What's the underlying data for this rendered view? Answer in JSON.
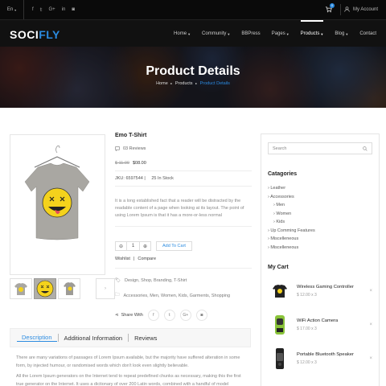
{
  "topbar": {
    "language": "En",
    "language_caret": "▾",
    "social": [
      "f",
      "𝕥",
      "G+",
      "in",
      "◙"
    ],
    "cart_count": "0",
    "account": "My Account"
  },
  "nav": {
    "logo_main": "SOCI",
    "logo_accent": "FLY",
    "items": [
      {
        "label": "Home"
      },
      {
        "label": "Community"
      },
      {
        "label": "BBPress"
      },
      {
        "label": "Pages"
      },
      {
        "label": "Products"
      },
      {
        "label": "Blog"
      },
      {
        "label": "Contact"
      }
    ]
  },
  "hero": {
    "title": "Product Details",
    "crumb_home": "Home",
    "crumb_mid": "Products",
    "crumb_current": "Product Details",
    "crumb_sep": "▸"
  },
  "product": {
    "name": "Emo T-Shirt",
    "reviews": "03 Reviews",
    "old_price": "$ 11.00",
    "price": "$08.00",
    "jku": "JKU: 6597544",
    "stock": "25 In Stock",
    "description": "It is a long established fact that a reader will be distracted by the readable content of a page when looking at its layout. The point of using Lorem Ipsum is that it has a more-or-less normal",
    "qty_minus": "⊖",
    "qty_value": "1",
    "qty_plus": "⊕",
    "add_to_cart": "Add To Cart",
    "wishlist": "Wishlist",
    "compare": "Compare",
    "tags_1": "Design, Shop, Branding, T-Shirt",
    "tags_2": "Accessories, Men, Women, Kids, Garments, Shopping",
    "share_with": "Share With",
    "share": [
      "f",
      "𝕥",
      "G+",
      "◙"
    ]
  },
  "sidebar": {
    "search_placeholder": "Search",
    "categories_title": "Catagories",
    "categories": [
      {
        "label": "Leather"
      },
      {
        "label": "Accessories"
      },
      {
        "label": "Men"
      },
      {
        "label": "Women"
      },
      {
        "label": "Kids"
      },
      {
        "label": "Up Comming Features"
      },
      {
        "label": "Miscelleneous"
      },
      {
        "label": "Miscelleneous"
      }
    ],
    "cart_title": "My Cart",
    "cart_items": [
      {
        "name": "Wireless Gaming Controller",
        "price": "$ 12.00 x 3"
      },
      {
        "name": "WiFi Action Camera",
        "price": "$ 17.00 x 3"
      },
      {
        "name": "Portable Bluetooth Speaker",
        "price": "$ 12.00 x 3"
      }
    ]
  },
  "tabs": {
    "description": "Description",
    "additional": "Additional Information",
    "reviews": "Reviews",
    "p1": "There are many variations of passages of Lorem Ipsum available, but the majority have suffered alteration in some form, by injected humour, or randomised words which don't look even slightly believable.",
    "p2": "All the Lorem Ipsum generators on the Internet tend to repeat predefined chunks as necessary, making this the first true generator on the Internet. It uses a dictionary of over 200 Latin words, combined with a handful of model"
  },
  "colors": {
    "accent": "#2b8be0",
    "topbar": "#0a0a0a",
    "navbar": "#111111"
  }
}
